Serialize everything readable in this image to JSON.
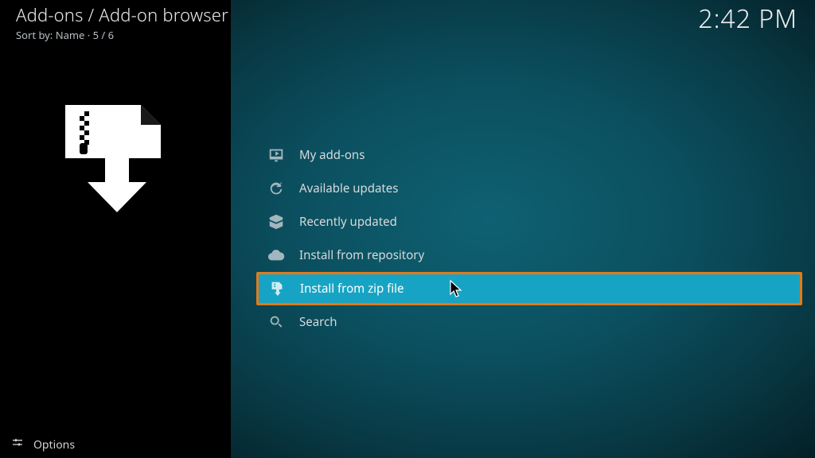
{
  "header": {
    "breadcrumb": "Add-ons / Add-on browser",
    "sort_prefix": "Sort by: ",
    "sort_field": "Name",
    "dot": " · ",
    "position": "5 / 6",
    "clock": "2:42 PM"
  },
  "menu": {
    "items": [
      {
        "id": "my-addons",
        "icon": "monitor-icon",
        "label": "My add-ons"
      },
      {
        "id": "available-updates",
        "icon": "refresh-icon",
        "label": "Available updates"
      },
      {
        "id": "recently-updated",
        "icon": "openbox-icon",
        "label": "Recently updated"
      },
      {
        "id": "install-repo",
        "icon": "cloud-down-icon",
        "label": "Install from repository"
      },
      {
        "id": "install-zip",
        "icon": "zip-down-icon",
        "label": "Install from zip file"
      },
      {
        "id": "search",
        "icon": "search-icon",
        "label": "Search"
      }
    ],
    "selected_index": 4
  },
  "footer": {
    "options_label": "Options"
  }
}
